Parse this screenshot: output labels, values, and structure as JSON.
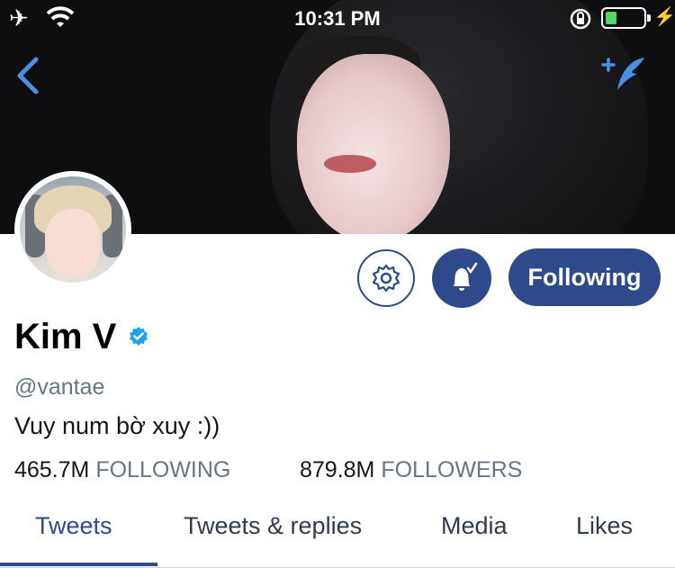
{
  "status_bar": {
    "time": "10:31 PM"
  },
  "profile": {
    "name": "Kim V",
    "handle": "@vantae",
    "bio": "Vuy num bờ xuy :))",
    "following_count": "465.7M",
    "following_label": "FOLLOWING",
    "followers_count": "879.8M",
    "followers_label": "FOLLOWERS"
  },
  "actions": {
    "following_label": "Following"
  },
  "tabs": [
    {
      "label": "Tweets",
      "active": true
    },
    {
      "label": "Tweets & replies",
      "active": false
    },
    {
      "label": "Media",
      "active": false
    },
    {
      "label": "Likes",
      "active": false
    }
  ],
  "colors": {
    "accent": "#2f4a8a",
    "verified": "#1da1f2",
    "battery": "#4cd964",
    "muted": "#657786"
  }
}
